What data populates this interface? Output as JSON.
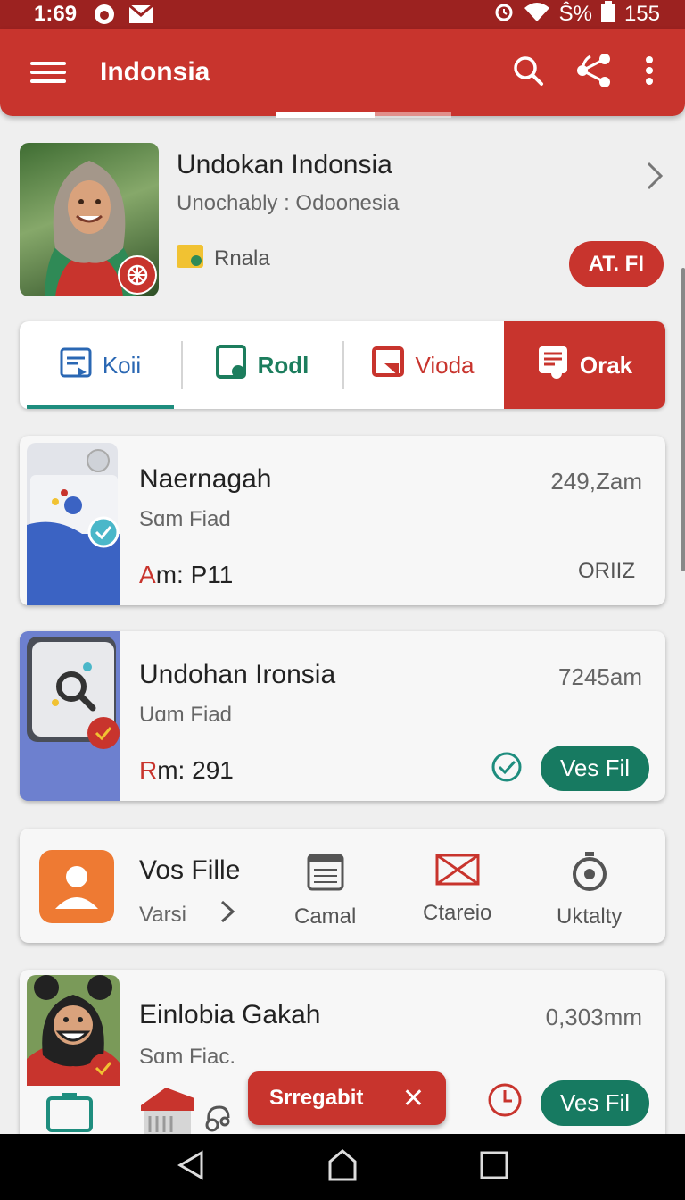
{
  "status_bar": {
    "time": "1:69",
    "battery_text": "Ŝ%",
    "battery_level": "155"
  },
  "app_bar": {
    "title": "Indonsia",
    "icons": [
      "menu-icon",
      "search-icon",
      "share-icon",
      "more-vert-icon"
    ]
  },
  "profile": {
    "name": "Undokan Indonsia",
    "subtitle": "Unochably : Odoonesia",
    "location": "Rnala",
    "action_label": "AT. FI"
  },
  "tabs": [
    {
      "label": "Koii",
      "icon": "media-icon"
    },
    {
      "label": "Rodl",
      "icon": "phone-icon"
    },
    {
      "label": "Vioda",
      "icon": "video-icon"
    },
    {
      "label": "Orak",
      "icon": "notes-icon",
      "selected": true
    }
  ],
  "items": [
    {
      "title": "Naernagah",
      "subtitle": "Sɑm Fiad",
      "meta_prefix": "A",
      "meta_rest": "m: P11",
      "time": "249,Zam",
      "status": "ORIIZ"
    },
    {
      "title": "Undohan Ironsia",
      "subtitle": "Uɑm Fiad",
      "meta_prefix": "R",
      "meta_rest": "m: 291",
      "time": "7245am",
      "action_label": "Ves Fil"
    },
    {
      "title": "Einlobia Gakah",
      "subtitle": "Sɑm Fiac.",
      "time": "0,303mm",
      "action_label": "Ves Fil"
    }
  ],
  "quick_actions": {
    "title": "Vos Fille",
    "subtitle": "Varsi",
    "items": [
      {
        "label": "Camal",
        "icon": "calendar-icon"
      },
      {
        "label": "Ctareio",
        "icon": "mail-icon"
      },
      {
        "label": "Uktalty",
        "icon": "timer-icon"
      }
    ]
  },
  "snackbar": {
    "label": "Srregabit",
    "close": "✕"
  },
  "colors": {
    "primary": "#c8342d",
    "status_bar": "#9c2220",
    "accent_green": "#177a61",
    "tab_blue": "#2a67b3"
  }
}
